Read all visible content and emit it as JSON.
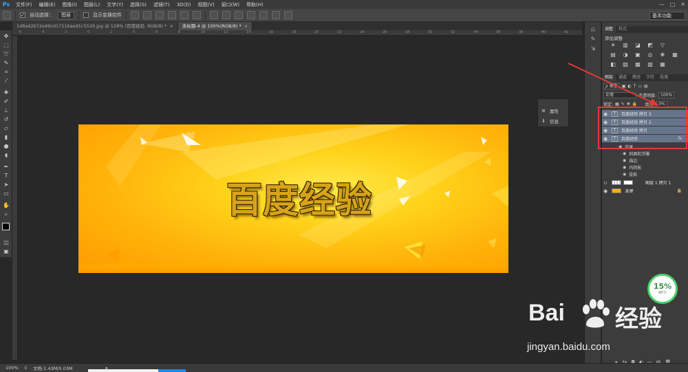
{
  "app": {
    "logo": "Ps"
  },
  "menubar": {
    "items": [
      "文件(F)",
      "编辑(E)",
      "图像(I)",
      "图层(L)",
      "文字(Y)",
      "选择(S)",
      "滤镜(T)",
      "3D(D)",
      "视图(V)",
      "窗口(W)",
      "帮助(H)"
    ],
    "window_controls": [
      "—",
      "□",
      "✕"
    ]
  },
  "options": {
    "auto_select_label": "自动选择：",
    "auto_select_value": "图层",
    "show_transform_label": "显示变换控件",
    "workspace": "基本功能"
  },
  "tabs": [
    {
      "label": "1d8ad2b72e49cd17116aed1c5529.jpg @ 128% (百度经验, RGB/8) *",
      "close": "×"
    },
    {
      "label": "未标题-4 @ 100%(RGB/8) *",
      "close": "×"
    }
  ],
  "ruler": {
    "top_ticks": [
      "6",
      "4",
      "2",
      "0",
      "2",
      "4",
      "6",
      "8",
      "10",
      "12",
      "14",
      "16",
      "18",
      "20",
      "22",
      "24",
      "26",
      "28",
      "30",
      "32",
      "34",
      "36",
      "38",
      "40",
      "42"
    ]
  },
  "canvas": {
    "heading": "百度经验"
  },
  "props_panel": {
    "items": [
      {
        "icon": "≡",
        "label": "属性"
      },
      {
        "icon": "ℹ",
        "label": "信息"
      }
    ]
  },
  "adjustments_panel": {
    "tabs": [
      "调整",
      "样式"
    ],
    "title": "添加调整",
    "icons": [
      "☀",
      "▥",
      "◪",
      "◩",
      "▽",
      "",
      "▤",
      "◑",
      "▣",
      "◎",
      "❀",
      "▦",
      "◧",
      "▨",
      "▩",
      "▧",
      "▦",
      ""
    ]
  },
  "layers_panel": {
    "tabs": [
      "图层",
      "通道",
      "路径",
      "字符",
      "段落"
    ],
    "filter_label": "ρ 类型",
    "blend_mode": "正常",
    "opacity_label": "不透明度:",
    "opacity_value": "100%",
    "lock_label": "锁定:",
    "fill_label": "填充:",
    "fill_value": "0%",
    "layers": [
      {
        "name": "百度经验 拷贝 3",
        "type": "T"
      },
      {
        "name": "百度经验 拷贝 2",
        "type": "T"
      },
      {
        "name": "百度经验 拷贝",
        "type": "T"
      },
      {
        "name": "百度经验",
        "type": "T",
        "fx": "fx"
      }
    ],
    "effects_label": "效果",
    "effects": [
      "斜面和浮雕",
      "描边",
      "内阴影",
      "投影"
    ],
    "extra_layers": [
      {
        "name": "图层 1 拷贝 1"
      },
      {
        "name": "背景",
        "lock": "🔒"
      }
    ],
    "footer_icons": [
      "⚭",
      "fx",
      "◘",
      "◐",
      "▭",
      "▤",
      "🗑"
    ]
  },
  "status": {
    "zoom": "100%",
    "doc_label": "文档:1.43M/5.03M",
    "arrow": "▸"
  },
  "perf_widget": {
    "percent": "15%",
    "temp": "46°C"
  },
  "watermark": {
    "brand_left": "Bai",
    "brand_right": "经验",
    "url": "jingyan.baidu.com"
  },
  "colors": {
    "accent_red": "#e53935",
    "selected_layer": "#66758b",
    "ps_blue": "#3ea6f2"
  }
}
